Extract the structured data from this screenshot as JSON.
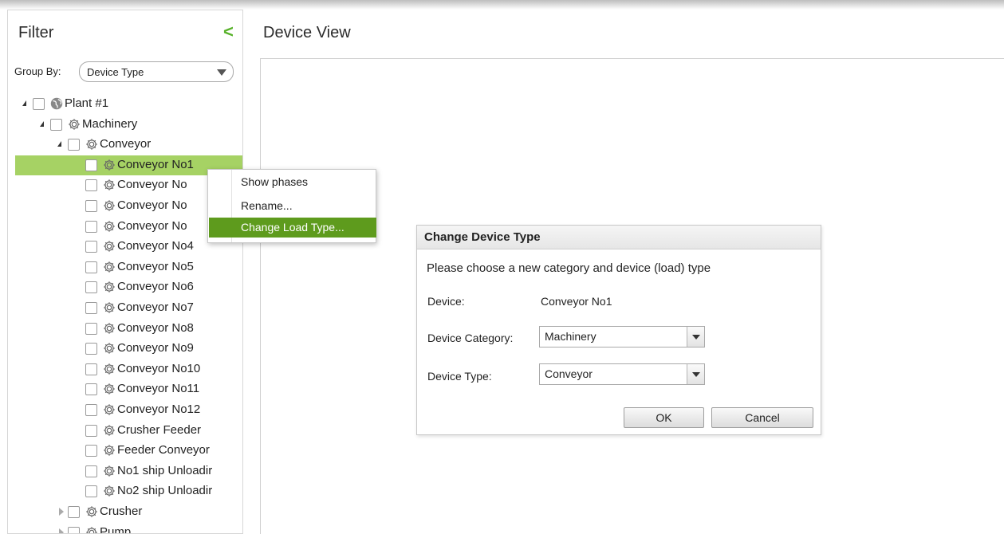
{
  "sidebar": {
    "title": "Filter",
    "collapse_glyph": "<",
    "group_by_label": "Group By:",
    "group_by_value": "Device Type",
    "tree": [
      {
        "label": "Plant #1",
        "level": 0,
        "arrow": "open",
        "icon": "globe-icon"
      },
      {
        "label": "Machinery",
        "level": 1,
        "arrow": "open",
        "icon": "gear-icon"
      },
      {
        "label": "Conveyor",
        "level": 2,
        "arrow": "open",
        "icon": "gear-icon"
      },
      {
        "label": "Conveyor No1",
        "level": 3,
        "arrow": "none",
        "icon": "gear-icon",
        "selected": true
      },
      {
        "label": "Conveyor No",
        "level": 3,
        "arrow": "none",
        "icon": "gear-icon"
      },
      {
        "label": "Conveyor No",
        "level": 3,
        "arrow": "none",
        "icon": "gear-icon"
      },
      {
        "label": "Conveyor No",
        "level": 3,
        "arrow": "none",
        "icon": "gear-icon"
      },
      {
        "label": "Conveyor No4",
        "level": 3,
        "arrow": "none",
        "icon": "gear-icon"
      },
      {
        "label": "Conveyor No5",
        "level": 3,
        "arrow": "none",
        "icon": "gear-icon"
      },
      {
        "label": "Conveyor No6",
        "level": 3,
        "arrow": "none",
        "icon": "gear-icon"
      },
      {
        "label": "Conveyor No7",
        "level": 3,
        "arrow": "none",
        "icon": "gear-icon"
      },
      {
        "label": "Conveyor No8",
        "level": 3,
        "arrow": "none",
        "icon": "gear-icon"
      },
      {
        "label": "Conveyor No9",
        "level": 3,
        "arrow": "none",
        "icon": "gear-icon"
      },
      {
        "label": "Conveyor No10",
        "level": 3,
        "arrow": "none",
        "icon": "gear-icon"
      },
      {
        "label": "Conveyor No11",
        "level": 3,
        "arrow": "none",
        "icon": "gear-icon"
      },
      {
        "label": "Conveyor No12",
        "level": 3,
        "arrow": "none",
        "icon": "gear-icon"
      },
      {
        "label": "Crusher Feeder",
        "level": 3,
        "arrow": "none",
        "icon": "gear-icon"
      },
      {
        "label": "Feeder Conveyor",
        "level": 3,
        "arrow": "none",
        "icon": "gear-icon"
      },
      {
        "label": "No1 ship Unloadir",
        "level": 3,
        "arrow": "none",
        "icon": "gear-icon"
      },
      {
        "label": "No2 ship Unloadir",
        "level": 3,
        "arrow": "none",
        "icon": "gear-icon"
      },
      {
        "label": "Crusher",
        "level": 2,
        "arrow": "closed",
        "icon": "gear-icon"
      },
      {
        "label": "Pump",
        "level": 2,
        "arrow": "closed",
        "icon": "gear-icon"
      }
    ]
  },
  "main": {
    "title": "Device View"
  },
  "context_menu": {
    "items": [
      {
        "label": "Show phases",
        "active": false
      },
      {
        "label": "Rename...",
        "active": false
      },
      {
        "label": "Change Load Type...",
        "active": true
      }
    ]
  },
  "dialog": {
    "title": "Change Device Type",
    "message": "Please choose a new category and device (load) type",
    "device_label": "Device:",
    "device_value": "Conveyor No1",
    "category_label": "Device Category:",
    "category_value": "Machinery",
    "type_label": "Device Type:",
    "type_value": "Conveyor",
    "ok_label": "OK",
    "cancel_label": "Cancel"
  },
  "colors": {
    "accent_green": "#58b22a",
    "selection_green": "#a6d264",
    "menu_active": "#5e9b1d"
  }
}
